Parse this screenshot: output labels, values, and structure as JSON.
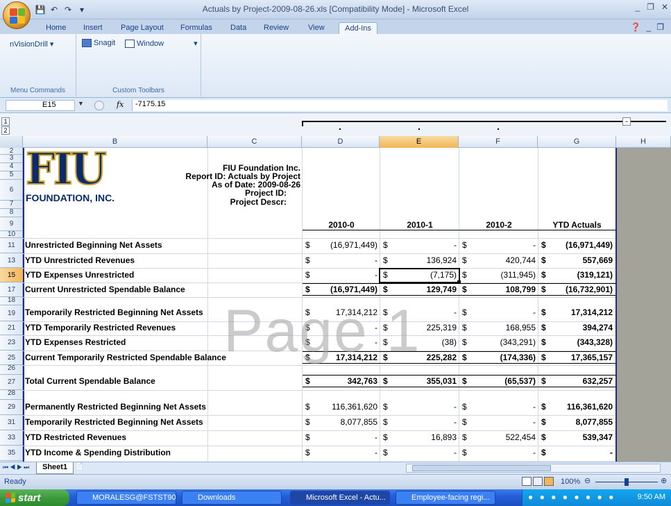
{
  "window": {
    "title": "Actuals by Project-2009-08-26.xls  [Compatibility Mode] - Microsoft Excel",
    "min": "_",
    "max": "❐",
    "close": "✕"
  },
  "ribbon_tabs": [
    "Home",
    "Insert",
    "Page Layout",
    "Formulas",
    "Data",
    "Review",
    "View",
    "Add-Ins"
  ],
  "ribbon": {
    "nvision": "nVisionDrill",
    "snagit": "Snagit",
    "window": "Window",
    "group1": "Menu Commands",
    "group2": "Custom Toolbars"
  },
  "formula_bar": {
    "name_box": "E15",
    "fx": "fx",
    "value": "-7175.15"
  },
  "outline_levels": [
    "1",
    "2"
  ],
  "columns": [
    "B",
    "C",
    "D",
    "E",
    "F",
    "G",
    "H"
  ],
  "rows": [
    "2",
    "3",
    "4",
    "5",
    "6",
    "7",
    "8",
    "9",
    "10",
    "11",
    "13",
    "15",
    "17",
    "18",
    "19",
    "21",
    "23",
    "25",
    "26",
    "27",
    "28",
    "29",
    "31",
    "33",
    "35"
  ],
  "logo": {
    "letters": "FIU",
    "sub": "FOUNDATION, INC."
  },
  "report_header": [
    "FIU Foundation Inc.",
    "Report ID: Actuals by Project",
    "As of Date: 2009-08-26",
    "Project ID:",
    "Project Descr:"
  ],
  "col_titles": [
    "2010-0",
    "2010-1",
    "2010-2",
    "YTD Actuals"
  ],
  "lines": [
    {
      "label": "Unrestricted Beginning Net Assets",
      "d": "(16,971,449)",
      "e": "-",
      "f": "-",
      "g": "(16,971,449)"
    },
    {
      "label": "YTD Unrestricted Revenues",
      "d": "-",
      "e": "136,924",
      "f": "420,744",
      "g": "557,669"
    },
    {
      "label": "YTD Expenses Unrestricted",
      "d": "-",
      "e": "(7,175)",
      "f": "(311,945)",
      "g": "(319,121)"
    },
    {
      "label": "Current Unrestricted Spendable Balance",
      "d": "(16,971,449)",
      "e": "129,749",
      "f": "108,799",
      "g": "(16,732,901)"
    },
    {
      "label": "Temporarily Restricted Beginning Net Assets",
      "d": "17,314,212",
      "e": "-",
      "f": "-",
      "g": "17,314,212"
    },
    {
      "label": "YTD Temporarily Restricted Revenues",
      "d": "-",
      "e": "225,319",
      "f": "168,955",
      "g": "394,274"
    },
    {
      "label": "YTD Expenses Restricted",
      "d": "-",
      "e": "(38)",
      "f": "(343,291)",
      "g": "(343,328)"
    },
    {
      "label": "Current Temporarily Restricted Spendable Balance",
      "d": "17,314,212",
      "e": "225,282",
      "f": "(174,336)",
      "g": "17,365,157"
    },
    {
      "label": "Total Current Spendable Balance",
      "d": "342,763",
      "e": "355,031",
      "f": "(65,537)",
      "g": "632,257"
    },
    {
      "label": "Permanently Restricted Beginning Net Assets",
      "d": "116,361,620",
      "e": "-",
      "f": "-",
      "g": "116,361,620"
    },
    {
      "label": "Temporarily Restricted Beginning Net Assets",
      "d": "8,077,855",
      "e": "-",
      "f": "-",
      "g": "8,077,855"
    },
    {
      "label": "YTD Restricted Revenues",
      "d": "-",
      "e": "16,893",
      "f": "522,454",
      "g": "539,347"
    },
    {
      "label": "YTD Income & Spending Distribution",
      "d": "-",
      "e": "-",
      "f": "-",
      "g": "-"
    }
  ],
  "currency": "$",
  "watermark": "Page 1",
  "sheet_tab": "Sheet1",
  "status": {
    "ready": "Ready",
    "zoom": "100%"
  },
  "taskbar": {
    "start": "start",
    "items": [
      "MORALESG@FSTST90",
      "Downloads",
      "Microsoft Excel - Actu...",
      "Employee-facing regi..."
    ],
    "clock": "9:50 AM"
  },
  "colors": {
    "fiu_blue": "#0a2a6b",
    "fiu_gold": "#c9a227",
    "selected_header": "#f2b658"
  }
}
